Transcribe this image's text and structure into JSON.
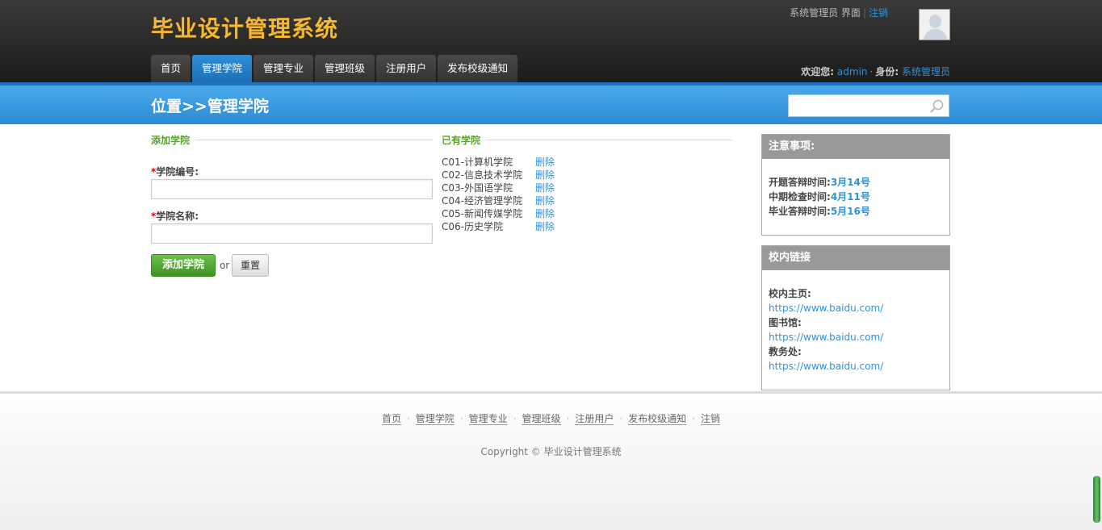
{
  "header": {
    "title": "毕业设计管理系统",
    "top_role": "系统管理员 界面",
    "logout": "注销",
    "nav": [
      "首页",
      "管理学院",
      "管理专业",
      "管理班级",
      "注册用户",
      "发布校级通知"
    ],
    "welcome_label": "欢迎您:",
    "user": "admin",
    "identity_label": "身份:",
    "role": "系统管理员"
  },
  "breadcrumb": "位置>>管理学院",
  "search": {
    "placeholder": ""
  },
  "form": {
    "section_title": "添加学院",
    "code_label": "学院编号:",
    "name_label": "学院名称:",
    "code_value": "",
    "name_value": "",
    "submit": "添加学院",
    "or": "or",
    "reset": "重置"
  },
  "colleges": {
    "section_title": "已有学院",
    "delete_label": "删除",
    "items": [
      "C01-计算机学院",
      "C02-信息技术学院",
      "C03-外国语学院",
      "C04-经济管理学院",
      "C05-新闻传媒学院",
      "C06-历史学院"
    ]
  },
  "notice": {
    "title": "注意事项:",
    "items": [
      {
        "label": "开题答辩时间:",
        "value": "3月14号"
      },
      {
        "label": "中期检查时间:",
        "value": "4月11号"
      },
      {
        "label": "毕业答辩时间:",
        "value": "5月16号"
      }
    ]
  },
  "links": {
    "title": "校内链接",
    "items": [
      {
        "label": "校内主页:",
        "url": "https://www.baidu.com/"
      },
      {
        "label": "图书馆:",
        "url": "https://www.baidu.com/"
      },
      {
        "label": "教务处:",
        "url": "https://www.baidu.com/"
      }
    ]
  },
  "footer": {
    "links": [
      "首页",
      "管理学院",
      "管理专业",
      "管理班级",
      "注册用户",
      "发布校级通知",
      "注销"
    ],
    "copyright": "Copyright © 毕业设计管理系统"
  },
  "colors": {
    "accent": "#f5b82e",
    "link": "#2f93d9",
    "active_tab": "#1e6fb3",
    "button_green": "#4fa82e"
  }
}
